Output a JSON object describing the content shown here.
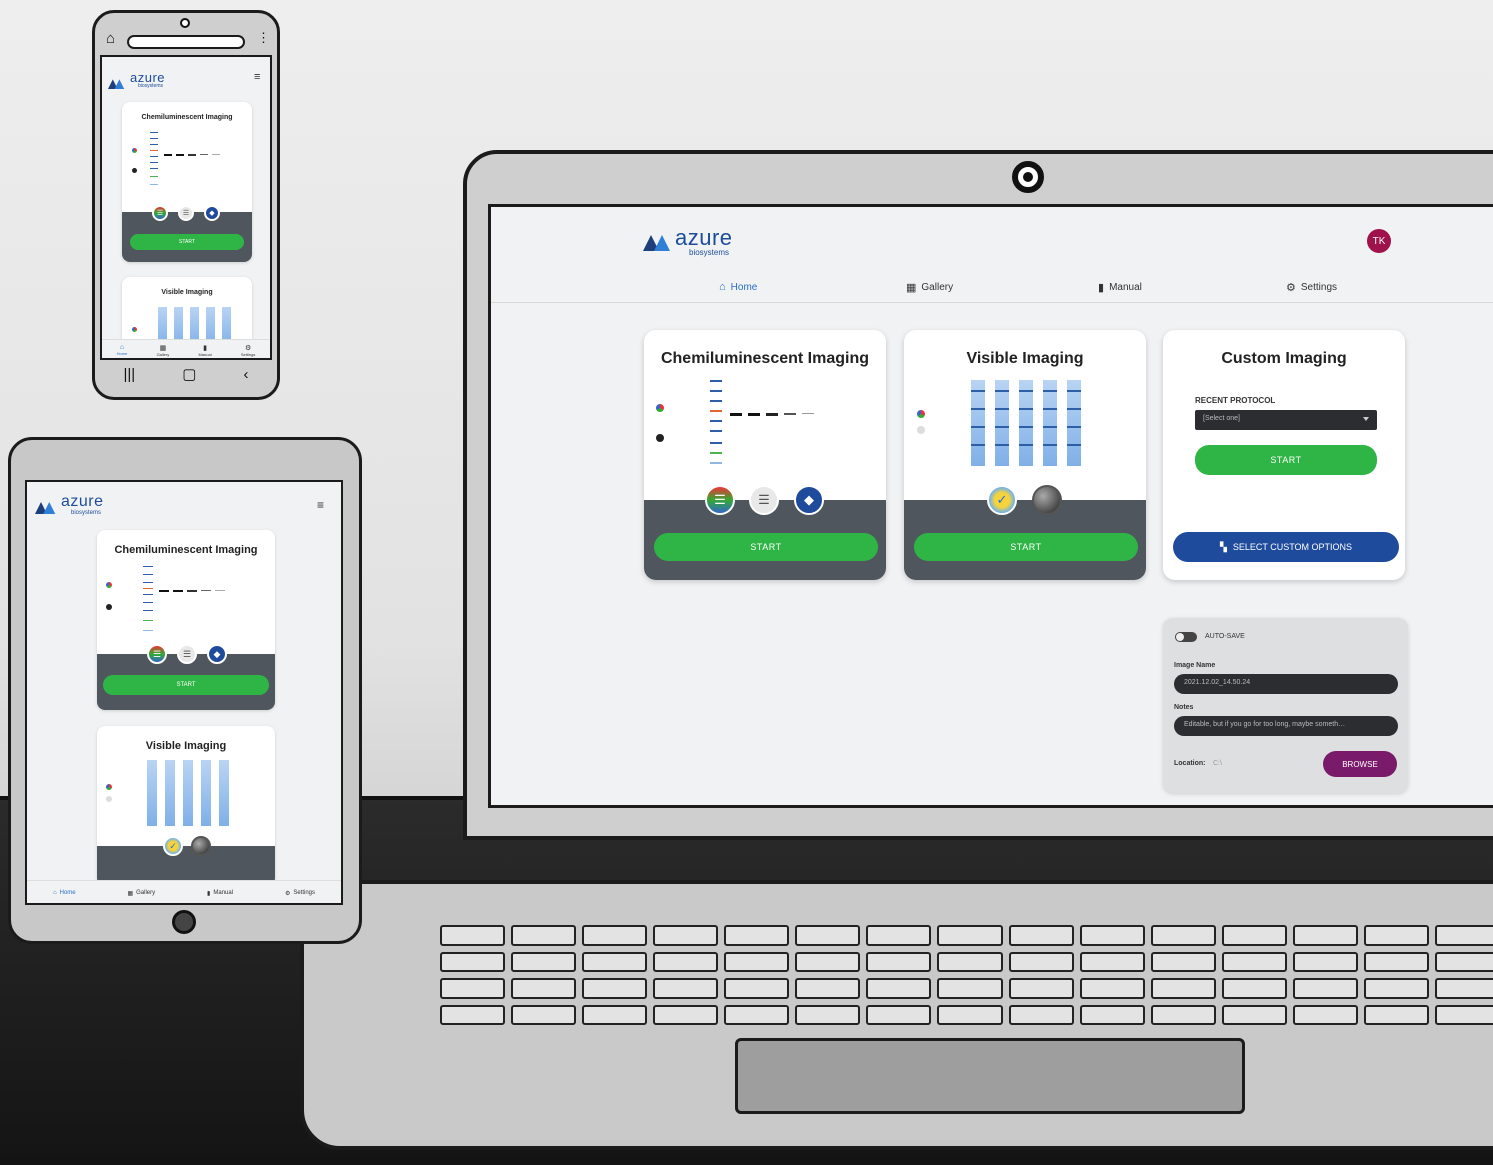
{
  "brand": {
    "word": "azure",
    "sub": "biosystems",
    "color": "#1d4d9a"
  },
  "user": {
    "initials": "TK",
    "avatar_color": "#a0124b"
  },
  "nav": [
    {
      "label": "Home",
      "icon": "home-icon",
      "active": true
    },
    {
      "label": "Gallery",
      "icon": "grid-icon",
      "active": false
    },
    {
      "label": "Manual",
      "icon": "book-icon",
      "active": false
    },
    {
      "label": "Settings",
      "icon": "gear-icon",
      "active": false
    }
  ],
  "cards": {
    "chemi": {
      "title": "Chemiluminescent Imaging",
      "start": "START"
    },
    "visible": {
      "title": "Visible Imaging",
      "start": "START"
    },
    "custom": {
      "title": "Custom Imaging",
      "recent_label": "RECENT PROTOCOL",
      "select_value": "[Select one]",
      "start": "START",
      "custom_options": "SELECT CUSTOM OPTIONS"
    }
  },
  "autosave": {
    "label": "AUTO-SAVE",
    "enabled": false,
    "image_name_label": "Image Name",
    "image_name_value": "2021.12.02_14.50.24",
    "notes_label": "Notes",
    "notes_value": "Editable, but if you go for too long, maybe someth…",
    "location_label": "Location:",
    "location_value": "C:\\",
    "browse": "BROWSE"
  },
  "colors": {
    "start_green": "#2fb545",
    "custom_blue": "#1f4b9d",
    "browse_purple": "#7a1a6a",
    "card_dark": "#50565e"
  }
}
